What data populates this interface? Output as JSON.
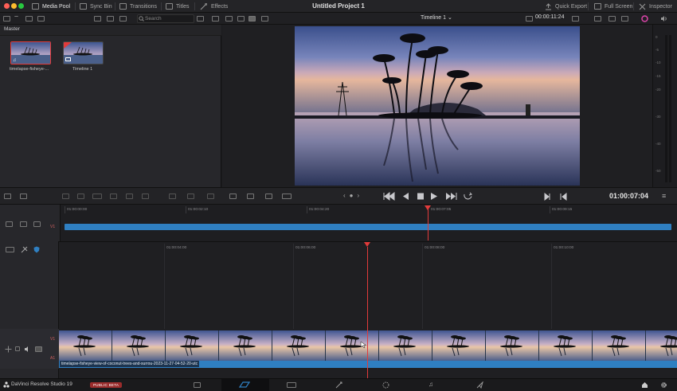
{
  "top_bar": {
    "tabs": [
      {
        "label": "Media Pool",
        "icon": "media-pool-icon",
        "active": true
      },
      {
        "label": "Sync Bin",
        "icon": "sync-bin-icon",
        "active": false
      },
      {
        "label": "Transitions",
        "icon": "transitions-icon",
        "active": false
      },
      {
        "label": "Titles",
        "icon": "titles-icon",
        "active": false
      },
      {
        "label": "Effects",
        "icon": "effects-icon",
        "active": false
      }
    ],
    "project_title": "Untitled Project 1",
    "right": {
      "quick_export": "Quick Export",
      "full_screen": "Full Screen",
      "inspector": "Inspector"
    }
  },
  "toolbar": {
    "search_placeholder": "Search",
    "timeline_name": "Timeline 1",
    "timecode": "00:00:11:24"
  },
  "media_pool": {
    "bin_name": "Master",
    "clips": [
      {
        "label": "timelapse-fisheye-...",
        "selected": true
      },
      {
        "label": "Timeline 1",
        "selected": false
      }
    ]
  },
  "meters": {
    "ticks": [
      "0",
      "-5",
      "-10",
      "-15",
      "-20",
      "-30",
      "-40",
      "-50"
    ]
  },
  "transport": {
    "timecode": "01:00:07:04"
  },
  "upper_timeline": {
    "ruler": [
      "01:00:00:00",
      "01:00:02:10",
      "01:00:04:20",
      "01:00:07:05",
      "01:00:09:15"
    ],
    "track": "V1"
  },
  "lower_timeline": {
    "ruler": [
      "01:00:04:00",
      "01:00:06:00",
      "01:00:08:00",
      "01:00:10:00"
    ],
    "video_track": "V1",
    "audio_track": "A1",
    "clip_name": "timelapse-fisheye-view-of-coconut-trees-and-surrou-2023-11-27-04-52-20-utc"
  },
  "bottom_bar": {
    "product": "DaVinci Resolve Studio 19",
    "badge": "PUBLIC BETA"
  },
  "colors": {
    "accent_blue": "#2f7fc1",
    "playhead_red": "#e23b3b",
    "beta_red": "#9a2c2c"
  }
}
